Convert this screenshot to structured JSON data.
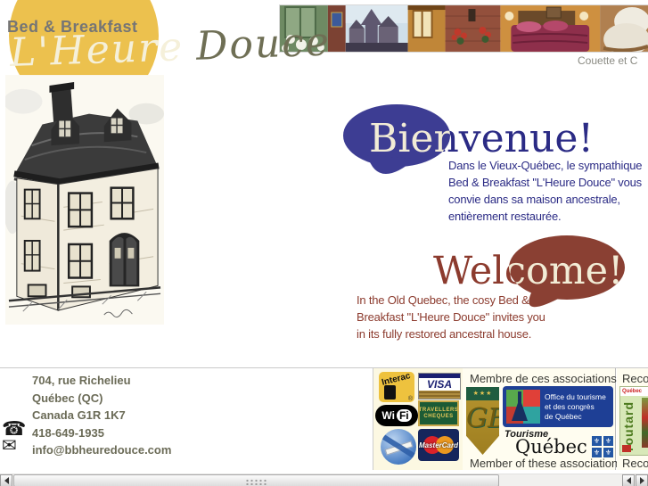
{
  "logo": {
    "tagline": "Bed & Breakfast",
    "name_script_light": "L'Heure",
    "name_script_dark": "Douce"
  },
  "photo_strip": {
    "caption": "Couette et C"
  },
  "bienvenue": {
    "title": "Bienvenue!",
    "lines": [
      "Dans le Vieux-Québec, le sympathique",
      "Bed & Breakfast \"L'Heure Douce\" vous",
      "convie dans sa maison ancestrale,",
      "entièrement restaurée."
    ]
  },
  "welcome": {
    "title": "Welcome!",
    "lines": [
      "In the Old Quebec, the cosy Bed &",
      "Breakfast \"L'Heure Douce\" invites you",
      "in its fully restored ancestral house."
    ]
  },
  "contact": {
    "address": [
      "704, rue Richelieu",
      "Québec (QC)",
      "Canada G1R 1K7"
    ],
    "phone": "418-649-1935",
    "email": "info@bbheuredouce.com",
    "phone_icon": "☎",
    "email_icon": "✉"
  },
  "payments": {
    "interac": "Interac",
    "interac_reg": "®",
    "visa": "VISA",
    "wifi_wi": "Wi",
    "wifi_fi": "Fi",
    "travellers_line1": "TRAVELLERS",
    "travellers_line2": "CHEQUES",
    "mastercard": "MasterCard"
  },
  "associations": {
    "header_fr": "Membre de ces associations",
    "footer_en": "Member of these associations",
    "shield_stars": "★★★",
    "shield_monogram": "GB",
    "office_lines": [
      "Office du tourisme",
      "et des congrès",
      "de Québec"
    ],
    "tourisme_word": "Tourisme",
    "quebec_word": "Québec",
    "fleur_symbol": "⚜"
  },
  "recommended": {
    "header": "Recom",
    "footer": "Recom",
    "routard_title": "routard",
    "cover_region": "Québec"
  },
  "colors": {
    "accent_yellow": "#ECC14E",
    "bubble_blue": "#3D3D93",
    "text_blue": "#2B2B85",
    "bubble_maroon": "#8A4033",
    "text_maroon": "#8C3B2E",
    "bubble_cream": "#F2ECD6",
    "contact_olive": "#6B6B57"
  }
}
